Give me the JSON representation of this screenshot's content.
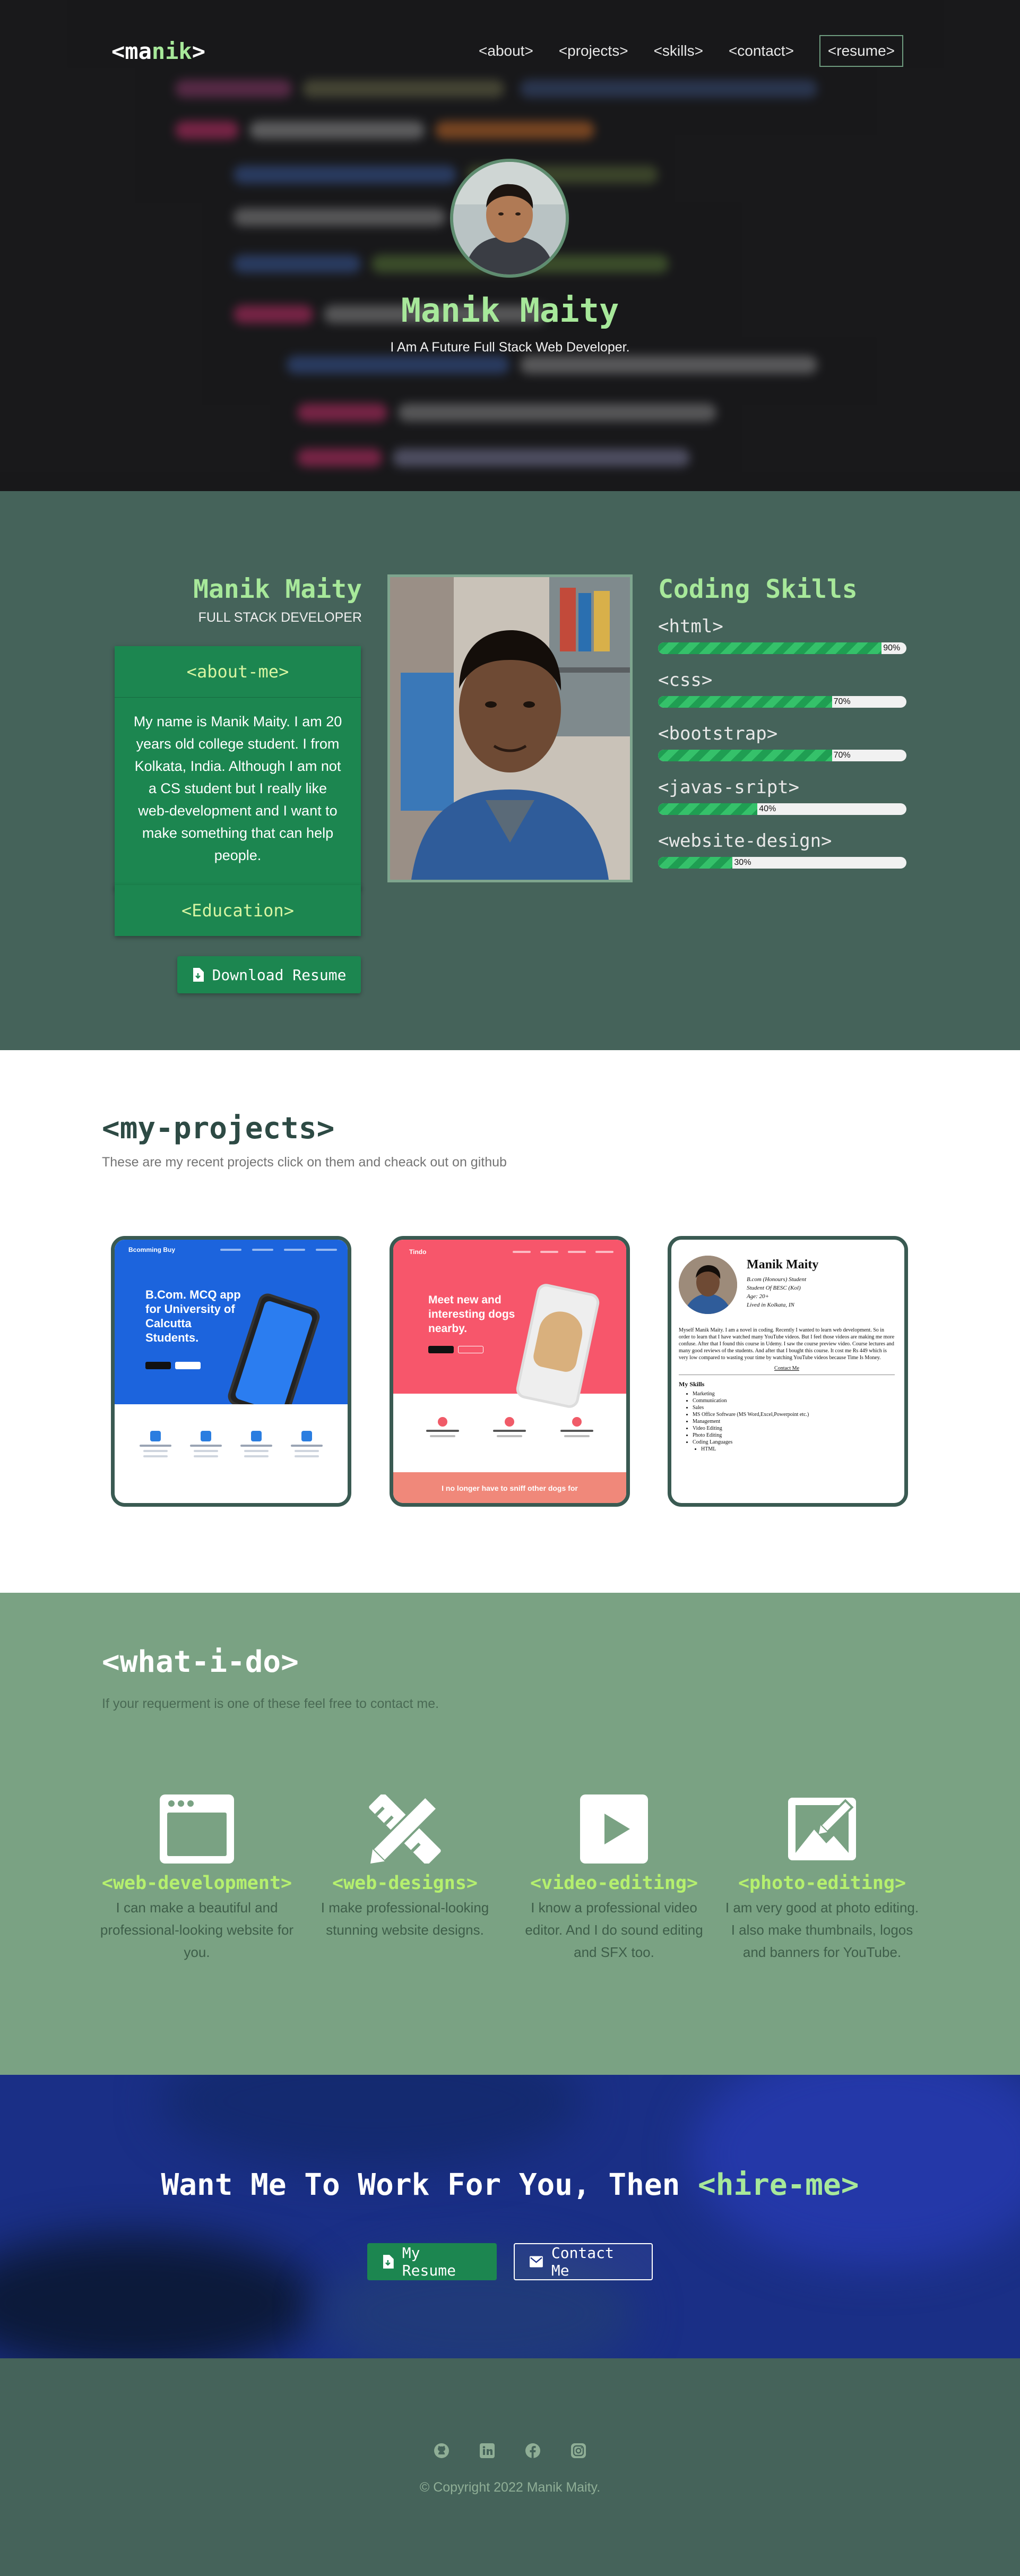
{
  "nav": {
    "logo_prefix": "<ma",
    "logo_accent": "nik",
    "logo_suffix": ">",
    "links": [
      "<about>",
      "<projects>",
      "<skills>",
      "<contact>"
    ],
    "resume": "<resume>"
  },
  "hero": {
    "name": "Manik Maity",
    "subtitle": "I Am A Future Full Stack Web Developer."
  },
  "about": {
    "name": "Manik Maity",
    "role": "FULL STACK DEVELOPER",
    "about_title": "<about-me>",
    "about_text": "My name is Manik Maity. I am 20 years old college student. I from Kolkata, India. Although I am not a CS student but I really like web-development and I want to make something that can help people.",
    "education_title": "<Education>",
    "download_label": "Download Resume"
  },
  "skills": {
    "title": "Coding Skills",
    "items": [
      {
        "name": "<html>",
        "percent": 90,
        "label": "90%"
      },
      {
        "name": "<css>",
        "percent": 70,
        "label": "70%"
      },
      {
        "name": "<bootstrap>",
        "percent": 70,
        "label": "70%"
      },
      {
        "name": "<javas-sript>",
        "percent": 40,
        "label": "40%"
      },
      {
        "name": "<website-design>",
        "percent": 30,
        "label": "30%"
      }
    ]
  },
  "projects": {
    "title": "<my-projects>",
    "subtitle": "These are my recent projects click on them and cheack out on github",
    "p1": {
      "brand": "Bcomming Buy",
      "headline": "B.Com. MCQ app for University of Calcutta Students."
    },
    "p2": {
      "brand": "Tindo",
      "headline": "Meet new and interesting dogs nearby.",
      "footer": "I no longer have to sniff other dogs for"
    },
    "p3": {
      "name": "Manik Maity",
      "line1": "B.com (Honours) Student",
      "line2": "Student Of BESC (Kol)",
      "line3": "Age: 20+",
      "line4": "Lived in Kolkata, IN",
      "para": "Myself Manik Maity. I am a novel in coding. Recently I wanted to learn web development. So in order to learn that I have watched many YouTube videos. But I feel those videos are making me more confuse. After that I found this course in Udemy. I saw the course preview video. Course lectures and many good reviews of the students. And after that I bought this course. It cost me Rs 449 which is very low compared to wasting your time by watching YouTube videos because Time Is Money.",
      "contact": "Contact Me",
      "skills_title": "My Skills",
      "skills": [
        "Marketing",
        "Communication",
        "Sales",
        "MS Office Software (MS Word,Excel,Powerpoint etc.)",
        "Management",
        "Video Editing",
        "Photo Editing",
        "Coding Languages",
        "HTML"
      ]
    }
  },
  "services": {
    "title": "<what-i-do>",
    "subtitle": "If your requerment is one of these feel free to contact me.",
    "items": [
      {
        "title": "<web-development>",
        "desc": "I can make a beautiful and professional-looking website for you."
      },
      {
        "title": "<web-designs>",
        "desc": "I make professional-looking stunning website designs."
      },
      {
        "title": "<video-editing>",
        "desc": "I know a professional video editor. And I do sound editing and SFX too."
      },
      {
        "title": "<photo-editing>",
        "desc": "I am very good at photo editing. I also make thumbnails, logos and banners for YouTube."
      }
    ]
  },
  "cta": {
    "title_main": "Want Me To Work For You, Then ",
    "title_accent": "<hire-me>",
    "resume_button": "My Resume",
    "contact_button": "Contact Me"
  },
  "footer": {
    "icons": [
      "github-icon",
      "linkedin-icon",
      "facebook-icon",
      "instagram-icon"
    ],
    "copyright": "© Copyright 2022 Manik Maity."
  },
  "colors": {
    "accent_green": "#a7e89a",
    "button_green": "#1c8650",
    "about_bg": "#45635a",
    "services_bg": "#7aa283"
  }
}
